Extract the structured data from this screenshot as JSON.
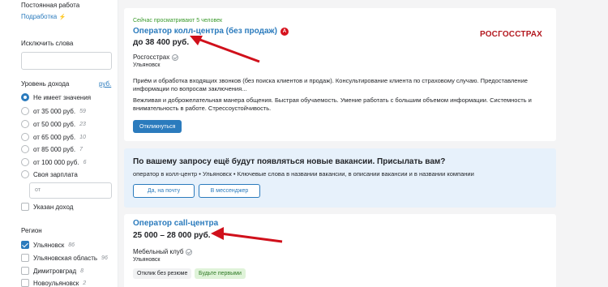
{
  "sidebar": {
    "permanent_work": "Постоянная работа",
    "part_time": "Подработка",
    "exclude_words": "Исключить слова",
    "income_level": "Уровень дохода",
    "currency": "руб.",
    "income_options": [
      {
        "label": "Не имеет значения",
        "count": ""
      },
      {
        "label": "от 35 000 руб.",
        "count": "59"
      },
      {
        "label": "от 50 000 руб.",
        "count": "23"
      },
      {
        "label": "от 65 000 руб.",
        "count": "10"
      },
      {
        "label": "от 85 000 руб.",
        "count": "7"
      },
      {
        "label": "от 100 000 руб.",
        "count": "6"
      }
    ],
    "own_salary": "Своя зарплата",
    "from_placeholder": "от",
    "income_specified": "Указан доход",
    "region": "Регион",
    "regions": [
      {
        "label": "Ульяновск",
        "count": "86",
        "checked": true
      },
      {
        "label": "Ульяновская область",
        "count": "96",
        "checked": false
      },
      {
        "label": "Димитровград",
        "count": "8",
        "checked": false
      },
      {
        "label": "Новоульяновск",
        "count": "2",
        "checked": false
      }
    ]
  },
  "vacancy1": {
    "viewers": "Сейчас просматривают 5 человек",
    "title": "Оператор колл-центра (без продаж)",
    "badge": "А",
    "salary": "до 38 400 руб.",
    "company": "Росгосстрах",
    "city": "Ульяновск",
    "desc1": "Приём и обработка входящих звонков (без поиска клиентов и продаж). Консультирование клиента по страховому случаю. Предоставление информации по вопросам заключения...",
    "desc2": "Вежливая и доброжелательная манера общения. Быстрая обучаемость. Умение работать с большим объемом информации. Системность и внимательность в работе. Стрессоустойчивость.",
    "apply": "Откликнуться",
    "logo": "РОСГОССТРАХ"
  },
  "notice": {
    "title": "По вашему запросу ещё будут появляться новые вакансии. Присылать вам?",
    "sub": "оператор в колл-центр • Ульяновск • Ключевые слова в названии вакансии, в описании вакансии и в названии компании",
    "yes": "Да, на почту",
    "messenger": "В мессенджер"
  },
  "vacancy2": {
    "title": "Оператор call-центра",
    "salary": "25 000 – 28 000 руб.",
    "company": "Мебельный клуб",
    "city": "Ульяновск",
    "tag1": "Отклик без резюме",
    "tag2": "Будьте первыми"
  },
  "colors": {
    "accent": "#2b7bbd",
    "arrow": "#d0101b",
    "green_tag": "#dff3d9"
  }
}
